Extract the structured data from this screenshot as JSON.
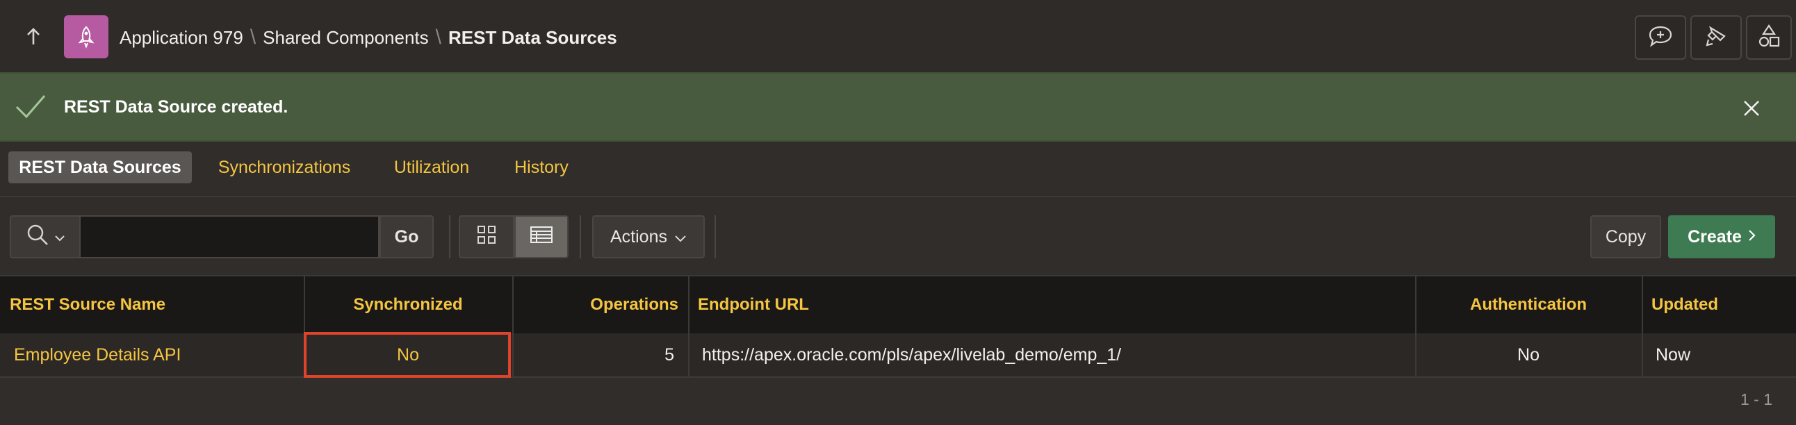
{
  "header": {
    "breadcrumbs": [
      "Application 979",
      "Shared Components",
      "REST Data Sources"
    ],
    "icons": [
      "up-arrow-icon",
      "rocket-icon",
      "feedback-icon",
      "marker-icon",
      "shapes-icon"
    ],
    "app_color": "#b65ba1"
  },
  "notification": {
    "message": "REST Data Source created.",
    "color": "#495b3f"
  },
  "tabs": [
    {
      "label": "REST Data Sources",
      "active": true
    },
    {
      "label": "Synchronizations",
      "active": false
    },
    {
      "label": "Utilization",
      "active": false
    },
    {
      "label": "History",
      "active": false
    }
  ],
  "toolbar": {
    "search_value": "",
    "go_label": "Go",
    "actions_label": "Actions",
    "copy_label": "Copy",
    "create_label": "Create"
  },
  "table": {
    "columns": [
      "REST Source Name",
      "Synchronized",
      "Operations",
      "Endpoint URL",
      "Authentication",
      "Updated"
    ],
    "rows": [
      {
        "name": "Employee Details API",
        "synchronized": "No",
        "operations": "5",
        "endpoint": "https://apex.oracle.com/pls/apex/livelab_demo/emp_1/",
        "authentication": "No",
        "updated": "Now"
      }
    ]
  },
  "pagination": "1 - 1",
  "accent_color": "#f5c542",
  "create_color": "#3f7b52"
}
